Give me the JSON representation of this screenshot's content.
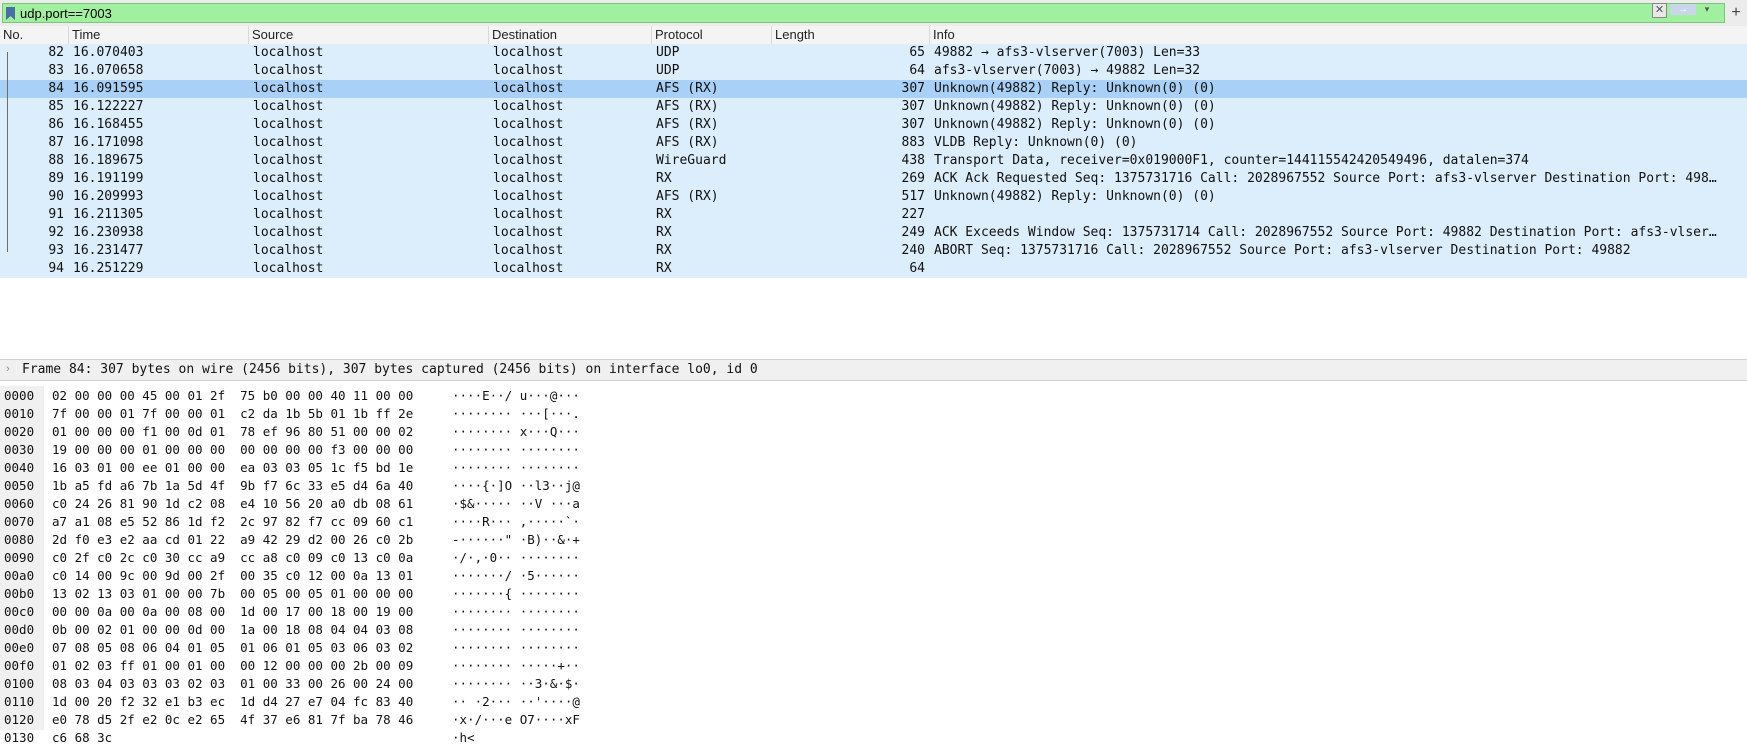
{
  "filter": {
    "value": "udp.port==7003",
    "clear_glyph": "✕",
    "apply_glyph": "→",
    "dropdown_glyph": "▾",
    "add_glyph": "+"
  },
  "columns": [
    "No.",
    "Time",
    "Source",
    "Destination",
    "Protocol",
    "Length",
    "Info"
  ],
  "packets": [
    {
      "no": "82",
      "time": "16.070403",
      "src": "localhost",
      "dst": "localhost",
      "proto": "UDP",
      "len": "65",
      "info": "49882 → afs3-vlserver(7003) Len=33"
    },
    {
      "no": "83",
      "time": "16.070658",
      "src": "localhost",
      "dst": "localhost",
      "proto": "UDP",
      "len": "64",
      "info": "afs3-vlserver(7003) → 49882 Len=32"
    },
    {
      "no": "84",
      "time": "16.091595",
      "src": "localhost",
      "dst": "localhost",
      "proto": "AFS (RX)",
      "len": "307",
      "info": "Unknown(49882) Reply: Unknown(0) (0)"
    },
    {
      "no": "85",
      "time": "16.122227",
      "src": "localhost",
      "dst": "localhost",
      "proto": "AFS (RX)",
      "len": "307",
      "info": "Unknown(49882) Reply: Unknown(0) (0)"
    },
    {
      "no": "86",
      "time": "16.168455",
      "src": "localhost",
      "dst": "localhost",
      "proto": "AFS (RX)",
      "len": "307",
      "info": "Unknown(49882) Reply: Unknown(0) (0)"
    },
    {
      "no": "87",
      "time": "16.171098",
      "src": "localhost",
      "dst": "localhost",
      "proto": "AFS (RX)",
      "len": "883",
      "info": "VLDB Reply: Unknown(0) (0)"
    },
    {
      "no": "88",
      "time": "16.189675",
      "src": "localhost",
      "dst": "localhost",
      "proto": "WireGuard",
      "len": "438",
      "info": "Transport Data, receiver=0x019000F1, counter=144115542420549496, datalen=374"
    },
    {
      "no": "89",
      "time": "16.191199",
      "src": "localhost",
      "dst": "localhost",
      "proto": "RX",
      "len": "269",
      "info": "ACK Ack Requested  Seq: 1375731716  Call: 2028967552  Source Port: afs3-vlserver  Destination Port: 498…"
    },
    {
      "no": "90",
      "time": "16.209993",
      "src": "localhost",
      "dst": "localhost",
      "proto": "AFS (RX)",
      "len": "517",
      "info": "Unknown(49882) Reply: Unknown(0) (0)"
    },
    {
      "no": "91",
      "time": "16.211305",
      "src": "localhost",
      "dst": "localhost",
      "proto": "RX",
      "len": "227",
      "info": ""
    },
    {
      "no": "92",
      "time": "16.230938",
      "src": "localhost",
      "dst": "localhost",
      "proto": "RX",
      "len": "249",
      "info": "ACK Exceeds Window  Seq: 1375731714  Call: 2028967552  Source Port: 49882  Destination Port: afs3-vlser…"
    },
    {
      "no": "93",
      "time": "16.231477",
      "src": "localhost",
      "dst": "localhost",
      "proto": "RX",
      "len": "240",
      "info": "ABORT  Seq: 1375731716  Call: 2028967552  Source Port: afs3-vlserver  Destination Port: 49882"
    },
    {
      "no": "94",
      "time": "16.251229",
      "src": "localhost",
      "dst": "localhost",
      "proto": "RX",
      "len": "64",
      "info": ""
    }
  ],
  "detail": {
    "arrow": "›",
    "text": "Frame 84: 307 bytes on wire (2456 bits), 307 bytes captured (2456 bits) on interface lo0, id 0"
  },
  "hex": [
    {
      "off": "0000",
      "hex": "02 00 00 00 45 00 01 2f  75 b0 00 00 40 11 00 00",
      "ascii": "····E··/ u···@···"
    },
    {
      "off": "0010",
      "hex": "7f 00 00 01 7f 00 00 01  c2 da 1b 5b 01 1b ff 2e",
      "ascii": "········ ···[···."
    },
    {
      "off": "0020",
      "hex": "01 00 00 00 f1 00 0d 01  78 ef 96 80 51 00 00 02",
      "ascii": "········ x···Q···"
    },
    {
      "off": "0030",
      "hex": "19 00 00 00 01 00 00 00  00 00 00 00 f3 00 00 00",
      "ascii": "········ ········"
    },
    {
      "off": "0040",
      "hex": "16 03 01 00 ee 01 00 00  ea 03 03 05 1c f5 bd 1e",
      "ascii": "········ ········"
    },
    {
      "off": "0050",
      "hex": "1b a5 fd a6 7b 1a 5d 4f  9b f7 6c 33 e5 d4 6a 40",
      "ascii": "····{·]O ··l3··j@"
    },
    {
      "off": "0060",
      "hex": "c0 24 26 81 90 1d c2 08  e4 10 56 20 a0 db 08 61",
      "ascii": "·$&····· ··V ···a"
    },
    {
      "off": "0070",
      "hex": "a7 a1 08 e5 52 86 1d f2  2c 97 82 f7 cc 09 60 c1",
      "ascii": "····R··· ,·····`·"
    },
    {
      "off": "0080",
      "hex": "2d f0 e3 e2 aa cd 01 22  a9 42 29 d2 00 26 c0 2b",
      "ascii": "-······\" ·B)··&·+"
    },
    {
      "off": "0090",
      "hex": "c0 2f c0 2c c0 30 cc a9  cc a8 c0 09 c0 13 c0 0a",
      "ascii": "·/·,·0·· ········"
    },
    {
      "off": "00a0",
      "hex": "c0 14 00 9c 00 9d 00 2f  00 35 c0 12 00 0a 13 01",
      "ascii": "·······/ ·5······"
    },
    {
      "off": "00b0",
      "hex": "13 02 13 03 01 00 00 7b  00 05 00 05 01 00 00 00",
      "ascii": "·······{ ········"
    },
    {
      "off": "00c0",
      "hex": "00 00 0a 00 0a 00 08 00  1d 00 17 00 18 00 19 00",
      "ascii": "········ ········"
    },
    {
      "off": "00d0",
      "hex": "0b 00 02 01 00 00 0d 00  1a 00 18 08 04 04 03 08",
      "ascii": "········ ········"
    },
    {
      "off": "00e0",
      "hex": "07 08 05 08 06 04 01 05  01 06 01 05 03 06 03 02",
      "ascii": "········ ········"
    },
    {
      "off": "00f0",
      "hex": "01 02 03 ff 01 00 01 00  00 12 00 00 00 2b 00 09",
      "ascii": "········ ·····+··"
    },
    {
      "off": "0100",
      "hex": "08 03 04 03 03 03 02 03  01 00 33 00 26 00 24 00",
      "ascii": "········ ··3·&·$·"
    },
    {
      "off": "0110",
      "hex": "1d 00 20 f2 32 e1 b3 ec  1d d4 27 e7 04 fc 83 40",
      "ascii": "·· ·2··· ··'····@"
    },
    {
      "off": "0120",
      "hex": "e0 78 d5 2f e2 0c e2 65  4f 37 e6 81 7f ba 78 46",
      "ascii": "·x·/···e O7····xF"
    },
    {
      "off": "0130",
      "hex": "c6 68 3c",
      "ascii": "·h<"
    }
  ]
}
